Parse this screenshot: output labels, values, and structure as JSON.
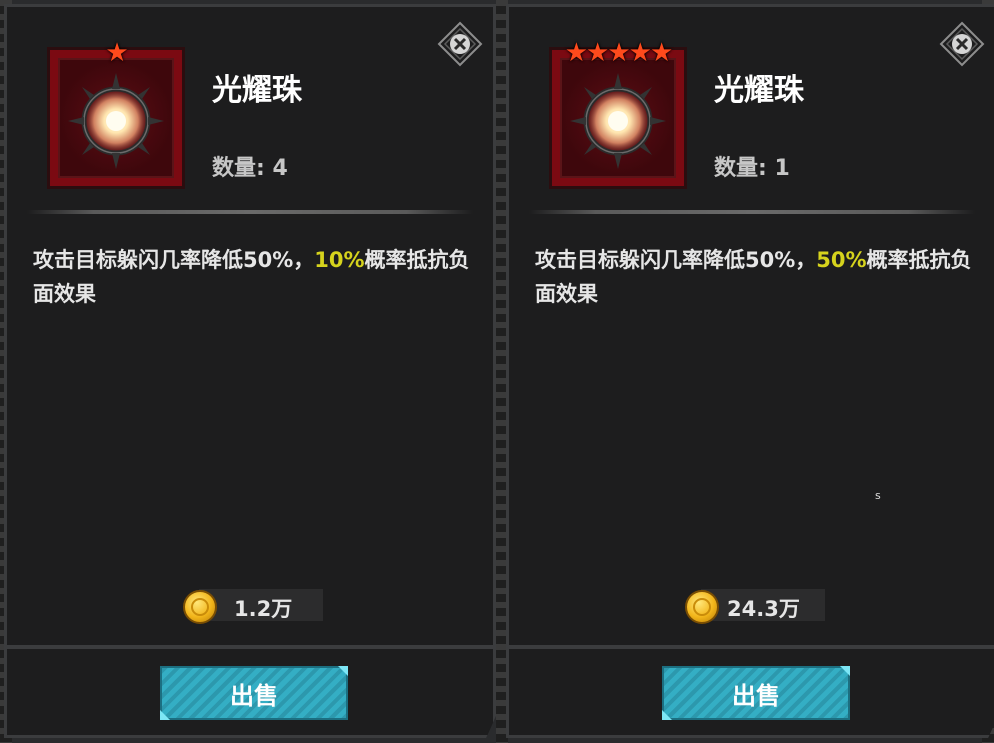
{
  "left_card": {
    "stars": "★",
    "item_name": "光耀珠",
    "quantity": "数量: 4",
    "desc_part1": "攻击目标躲闪几率降低50%，",
    "desc_highlight": "10%",
    "desc_part2": "概率抵抗负面效果",
    "price": "1.2万",
    "sell_label": "出售",
    "icons": {
      "close": "close-x-icon",
      "currency": "gold-coin-icon",
      "item": "radiant-orb-icon"
    }
  },
  "right_card": {
    "stars": "★★★★★",
    "item_name": "光耀珠",
    "quantity": "数量: 1",
    "desc_part1": "攻击目标躲闪几率降低50%，",
    "desc_highlight": "50%",
    "desc_part2": "概率抵抗负面效果",
    "price": "24.3万",
    "sell_label": "出售",
    "icons": {
      "close": "close-x-icon",
      "currency": "gold-coin-icon",
      "item": "radiant-orb-icon"
    }
  },
  "marker_text": "s",
  "colors": {
    "highlight": "#d6d31d",
    "star": "#ff4a1c",
    "sell_button": "#2c98ad",
    "frame_red": "#7b0a12"
  }
}
